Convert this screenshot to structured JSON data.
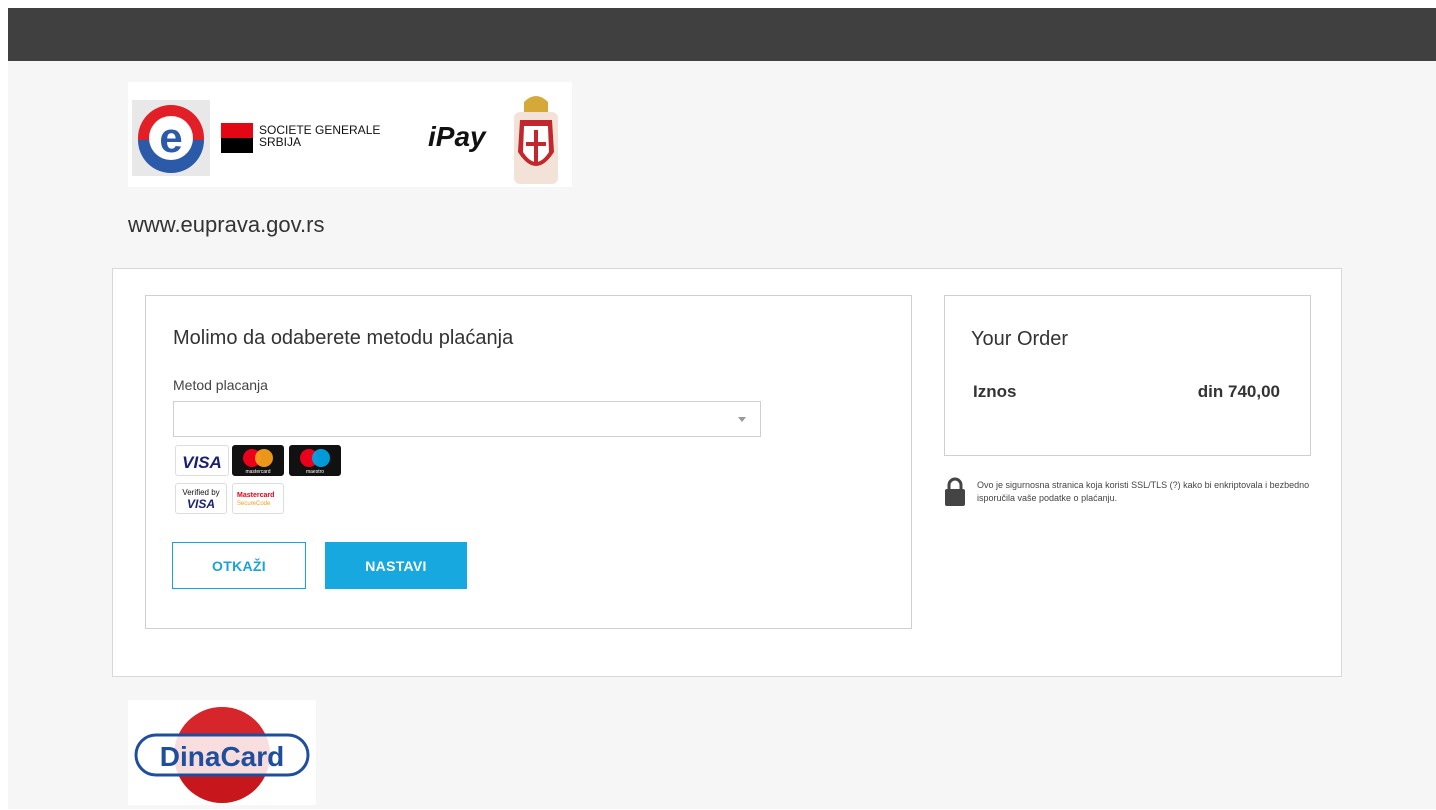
{
  "header": {},
  "logos": {
    "societe_line1": "SOCIETE GENERALE",
    "societe_line2": "SRBIJA",
    "ipay": "iPay",
    "eprava_letter": "e"
  },
  "site": {
    "url": "www.euprava.gov.rs"
  },
  "payment": {
    "title": "Molimo da odaberete metodu plaćanja",
    "method_label": "Metod placanja",
    "method_value": "",
    "cards": {
      "visa": "VISA",
      "mastercard": "mastercard",
      "maestro": "maestro",
      "verified_by": "Verified by",
      "verified_visa": "VISA",
      "mc_secure_1": "Mastercard",
      "mc_secure_2": "SecureCode"
    },
    "cancel_label": "OTKAŽI",
    "continue_label": "NASTAVI"
  },
  "order": {
    "title": "Your Order",
    "amount_label": "Iznos",
    "amount_value": "din 740,00"
  },
  "security": {
    "text": "Ovo je sigurnosna stranica koja koristi SSL/TLS (?) kako bi enkriptovala i bezbedno isporučila vaše podatke o plaćanju."
  },
  "footer": {
    "dinacard": "DinaCard"
  },
  "colors": {
    "accent": "#17a8e0",
    "topbar": "#404040",
    "background": "#f6f6f6"
  }
}
